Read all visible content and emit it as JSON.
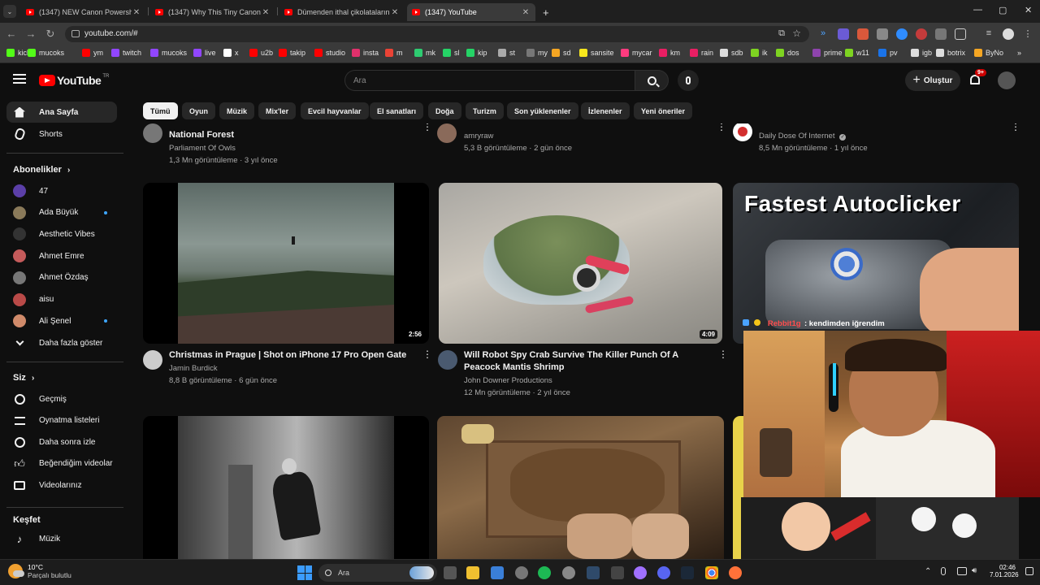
{
  "browser": {
    "tabs": [
      {
        "title": "(1347) NEW Canon Powershot V...",
        "close": "✕"
      },
      {
        "title": "(1347) Why This Tiny Canon Ca...",
        "close": "✕"
      },
      {
        "title": "Dümenden ithal çikolataların b...",
        "close": "✕"
      },
      {
        "title": "(1347) YouTube",
        "close": "✕"
      }
    ],
    "new_tab": "+",
    "url": "youtube.com/#",
    "window_controls": {
      "minimize": "—",
      "maximize": "▢",
      "close": "✕"
    }
  },
  "bookmarks": [
    {
      "label": "kick",
      "color": "#53fc18"
    },
    {
      "label": "mucoks",
      "color": "#53fc18"
    },
    {
      "label": "ym",
      "color": "#ff0000"
    },
    {
      "label": "twitch",
      "color": "#9146ff"
    },
    {
      "label": "mucoks",
      "color": "#9146ff"
    },
    {
      "label": "live",
      "color": "#9146ff"
    },
    {
      "label": "x",
      "color": "#ffffff"
    },
    {
      "label": "u2b",
      "color": "#ff0000"
    },
    {
      "label": "takip",
      "color": "#ff0000"
    },
    {
      "label": "studio",
      "color": "#ff0000"
    },
    {
      "label": "insta",
      "color": "#e1306c"
    },
    {
      "label": "m",
      "color": "#ea4335"
    },
    {
      "label": "mk",
      "color": "#2ecc71"
    },
    {
      "label": "sl",
      "color": "#25d366"
    },
    {
      "label": "kip",
      "color": "#25d366"
    },
    {
      "label": "st",
      "color": "#aaaaaa"
    },
    {
      "label": "my",
      "color": "#777777"
    },
    {
      "label": "sd",
      "color": "#f5a623"
    },
    {
      "label": "sansite",
      "color": "#f8e71c"
    },
    {
      "label": "mycar",
      "color": "#ff3b7f"
    },
    {
      "label": "km",
      "color": "#e91e63"
    },
    {
      "label": "rain",
      "color": "#e91e63"
    },
    {
      "label": "sdb",
      "color": "#dddddd"
    },
    {
      "label": "ik",
      "color": "#7ed321"
    },
    {
      "label": "dos",
      "color": "#7ed321"
    },
    {
      "label": "prime",
      "color": "#8e44ad"
    },
    {
      "label": "w11",
      "color": "#7ed321"
    },
    {
      "label": "pv",
      "color": "#1a73e8"
    },
    {
      "label": "igb",
      "color": "#dddddd"
    },
    {
      "label": "botrix",
      "color": "#dddddd"
    },
    {
      "label": "ByNo",
      "color": "#f5a623"
    }
  ],
  "youtube": {
    "logo_text": "YouTube",
    "logo_sup": "TR",
    "search_placeholder": "Ara",
    "create_label": "Oluştur",
    "notif_badge": "9+",
    "chips": [
      "Tümü",
      "Oyun",
      "Müzik",
      "Mix'ler",
      "Evcil hayvanlar",
      "El sanatları",
      "Doğa",
      "Turizm",
      "Son yüklenenler",
      "İzlenenler",
      "Yeni öneriler"
    ],
    "guide": {
      "home": "Ana Sayfa",
      "shorts": "Shorts",
      "subs_header": "Abonelikler",
      "subs": [
        {
          "name": "47",
          "color": "#5b3fa8"
        },
        {
          "name": "Ada Büyük",
          "color": "#8a7a5a"
        },
        {
          "name": "Aesthetic Vibes",
          "color": "#333333"
        },
        {
          "name": "Ahmet Emre",
          "color": "#c55b5b"
        },
        {
          "name": "Ahmet Özdaş",
          "color": "#777777"
        },
        {
          "name": "aisu",
          "color": "#b94a48"
        },
        {
          "name": "Ali Şenel",
          "color": "#d08a6a"
        }
      ],
      "show_more": "Daha fazla göster",
      "you_header": "Siz",
      "you": [
        "Geçmiş",
        "Oynatma listeleri",
        "Daha sonra izle",
        "Beğendiğim videolar",
        "Videolarınız"
      ],
      "explore_header": "Keşfet",
      "explore": [
        "Müzik"
      ]
    },
    "top_row": [
      {
        "title": "National Forest",
        "channel": "Parliament Of Owls",
        "meta": "1,3 Mn görüntüleme · 3 yıl önce"
      },
      {
        "channel": "amryraw",
        "meta": "5,3 B görüntüleme · 2 gün önce"
      },
      {
        "channel": "Daily Dose Of Internet",
        "meta": "8,5 Mn görüntüleme · 1 yıl önce"
      }
    ],
    "videos": [
      {
        "title": "Christmas in Prague | Shot on iPhone 17 Pro Open Gate",
        "channel": "Jamin Burdick",
        "meta": "8,8 B görüntüleme · 6 gün önce",
        "duration": "2:56"
      },
      {
        "title": "Will Robot Spy Crab Survive The Killer Punch Of A Peacock Mantis Shrimp",
        "channel": "John Downer Productions",
        "meta": "12 Mn görüntüleme · 2 yıl önce",
        "duration": "4:09"
      },
      {
        "thumb_text": "Fastest Autoclicker"
      }
    ],
    "overlay_chat": {
      "user": "Rebbit1g",
      "message": ": kendimden iğrendim"
    }
  },
  "taskbar": {
    "weather_temp": "10°C",
    "weather_desc": "Parçalı bulutlu",
    "search": "Ara",
    "time": "02:46",
    "date": "7.01.2026",
    "tray_up": "⌃"
  }
}
